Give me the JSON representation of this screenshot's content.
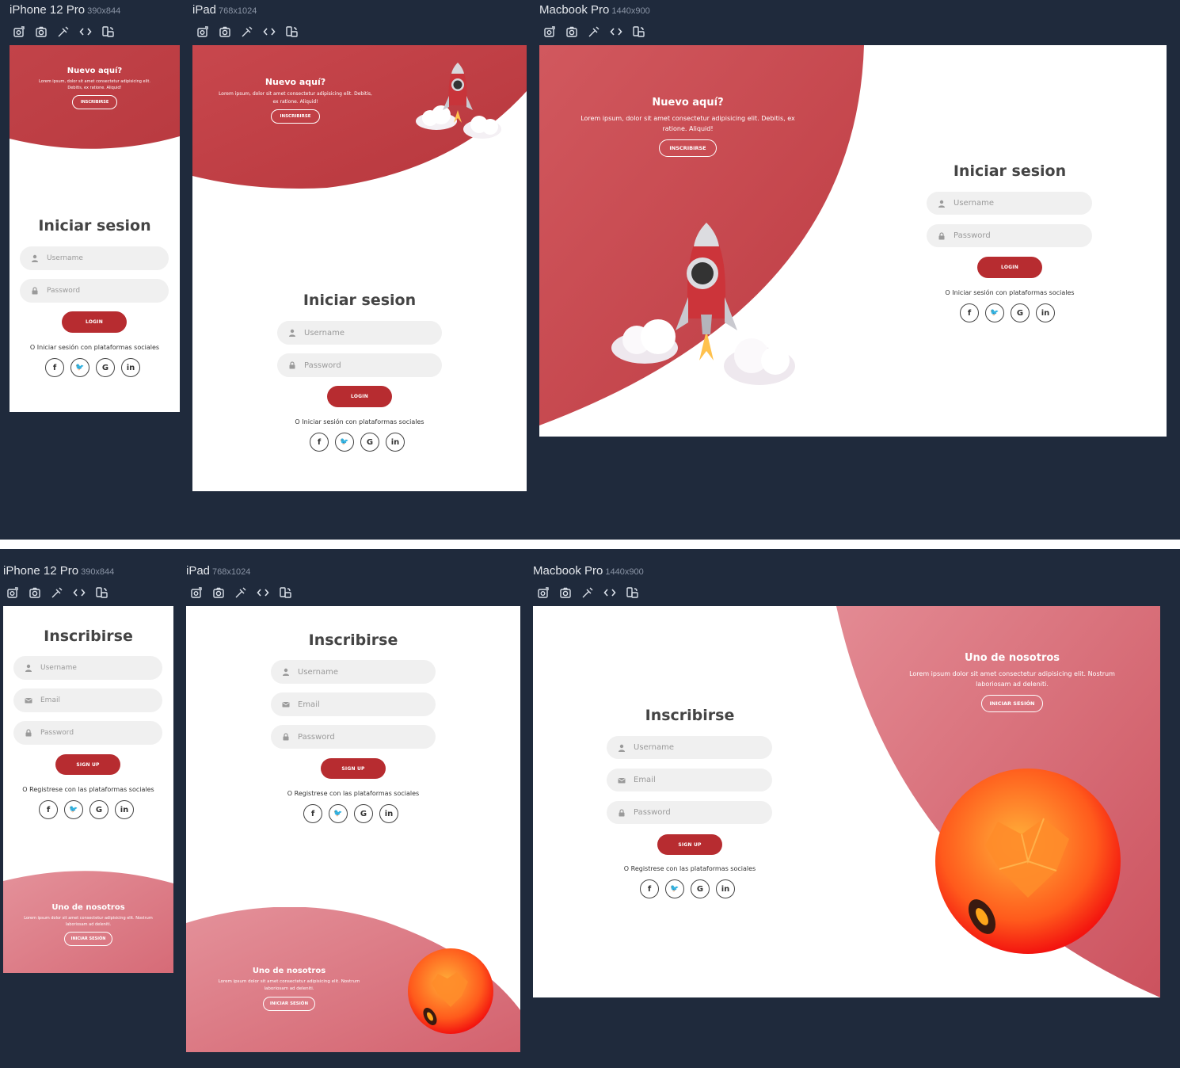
{
  "devices": [
    {
      "name": "iPhone 12 Pro",
      "size": "390x844"
    },
    {
      "name": "iPad",
      "size": "768x1024"
    },
    {
      "name": "Macbook Pro",
      "size": "1440x900"
    }
  ],
  "colors": {
    "background": "#1f2a3c",
    "brand_red": "#b72c30",
    "pink": "#e0808a",
    "field_bg": "#f0f0f0"
  },
  "icons": [
    "edit-photo-icon",
    "camera-icon",
    "syringe-icon",
    "code-icon",
    "rotate-device-icon"
  ],
  "login": {
    "overlay_title": "Nuevo aquí?",
    "overlay_text": "Lorem ipsum, dolor sit amet consectetur adipisicing elit. Debitis, ex ratione. Aliquid!",
    "overlay_button": "INSCRIBIRSE",
    "title": "Iniciar sesion",
    "username_placeholder": "Username",
    "password_placeholder": "Password",
    "button": "LOGIN",
    "social_text": "O Iniciar sesión con plataformas sociales"
  },
  "signup": {
    "overlay_title": "Uno de nosotros",
    "overlay_text": "Lorem ipsum dolor sit amet consectetur adipisicing elit. Nostrum laboriosam ad deleniti.",
    "overlay_button": "INICIAR SESIÓN",
    "title": "Inscribirse",
    "username_placeholder": "Username",
    "email_placeholder": "Email",
    "password_placeholder": "Password",
    "button": "SIGN UP",
    "social_text": "O Registrese con las plataformas sociales"
  },
  "socials": [
    {
      "name": "facebook",
      "glyph": "f"
    },
    {
      "name": "twitter",
      "glyph": "🐦"
    },
    {
      "name": "google",
      "glyph": "G"
    },
    {
      "name": "linkedin",
      "glyph": "in"
    }
  ]
}
